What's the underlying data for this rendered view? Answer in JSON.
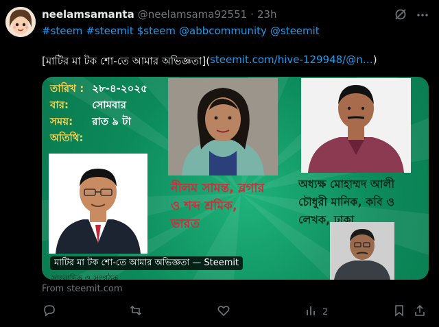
{
  "author": {
    "name": "neelamsamanta",
    "handle": "@neelamsama92551",
    "separator": "·",
    "time": "23h"
  },
  "tags": [
    "#steem",
    "#steemit",
    "$steem",
    "@abbcommunity",
    "@steemit"
  ],
  "post": {
    "title_text": "[মাটির মা টক শো-তে আমার অভিজ্ঞতা](",
    "link_text": "steemit.com/hive-129948/@n…",
    "close_paren": ")"
  },
  "card": {
    "rows": [
      {
        "label": "তারিখ :",
        "value": "২৮-৪-২০২৫"
      },
      {
        "label": "বার:",
        "value": "সোমবার"
      },
      {
        "label": "সময়:",
        "value": "রাত ৯ টা"
      },
      {
        "label": "অতিথি:",
        "value": ""
      }
    ],
    "guest1_caption": [
      "নীলম সামন্ত, ব্লগার",
      "ও শব্দ শ্রমিক,",
      "ভারত"
    ],
    "guest2_caption": [
      "অধ্যক্ষ মোহাম্মদ আলী",
      "চৌধুরী মানিক, কবি ও",
      "লেখক, ঢাকা"
    ],
    "overlay_title": "মাটির মা টক শো-তে আমার অভিজ্ঞতা — Steemit",
    "bottom_partial": "সাংবাদিক ও সংগঠক"
  },
  "source": "From steemit.com",
  "actions": {
    "reply_count": "",
    "repost_count": "",
    "like_count": "",
    "views_count": "2"
  },
  "icons": {
    "grok": "grok-icon",
    "more": "more-icon",
    "reply": "reply-icon",
    "repost": "repost-icon",
    "like": "like-icon",
    "views": "views-icon",
    "bookmark": "bookmark-icon",
    "share": "share-icon"
  },
  "colors": {
    "background": "#000000",
    "text": "#e7e9ea",
    "muted": "#71767b",
    "link": "#1d9bf0",
    "card_green": "#0c8a5b"
  }
}
